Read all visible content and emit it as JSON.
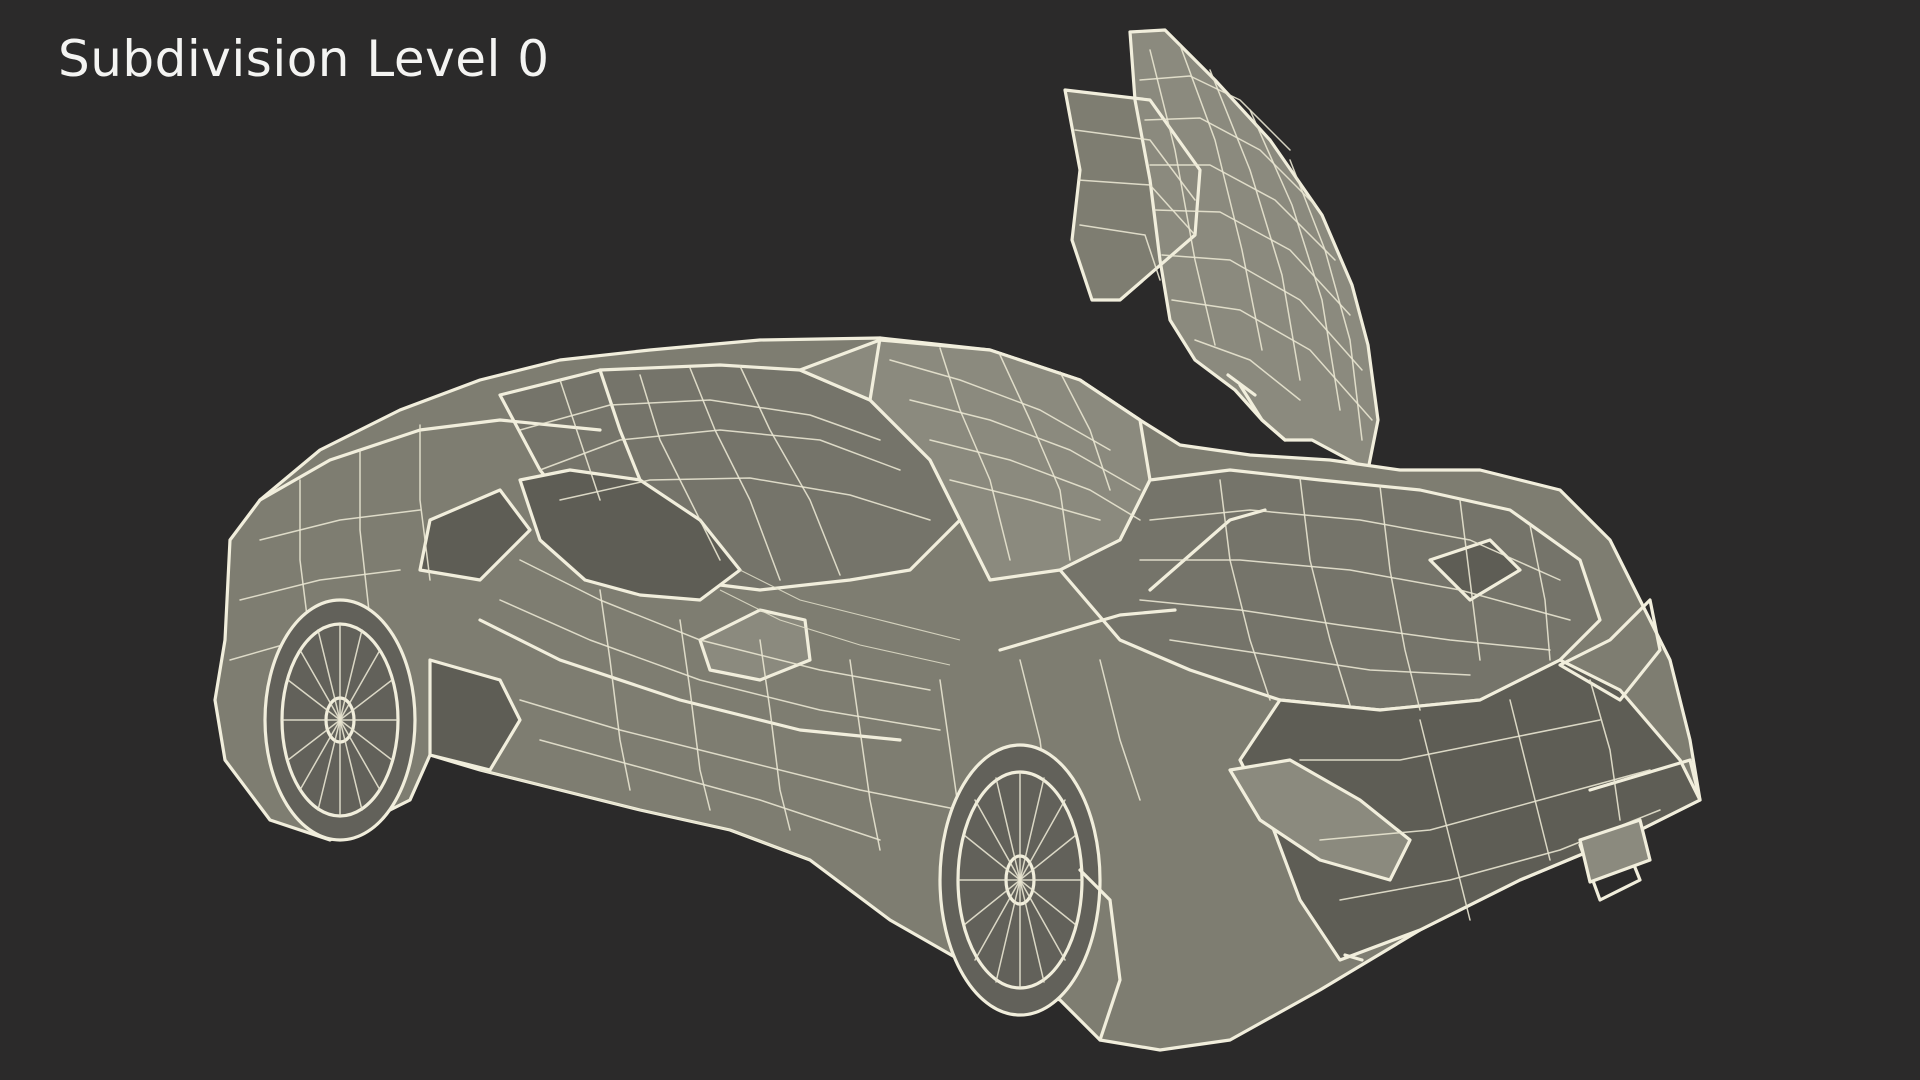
{
  "caption": "Subdivision Level 0",
  "colors": {
    "background": "#2b2a2a",
    "surface": "#7e7d71",
    "wireframe": "#f1eedc",
    "caption_text": "#f4f4f2"
  },
  "subject": {
    "icon": "wireframe-sports-car"
  }
}
